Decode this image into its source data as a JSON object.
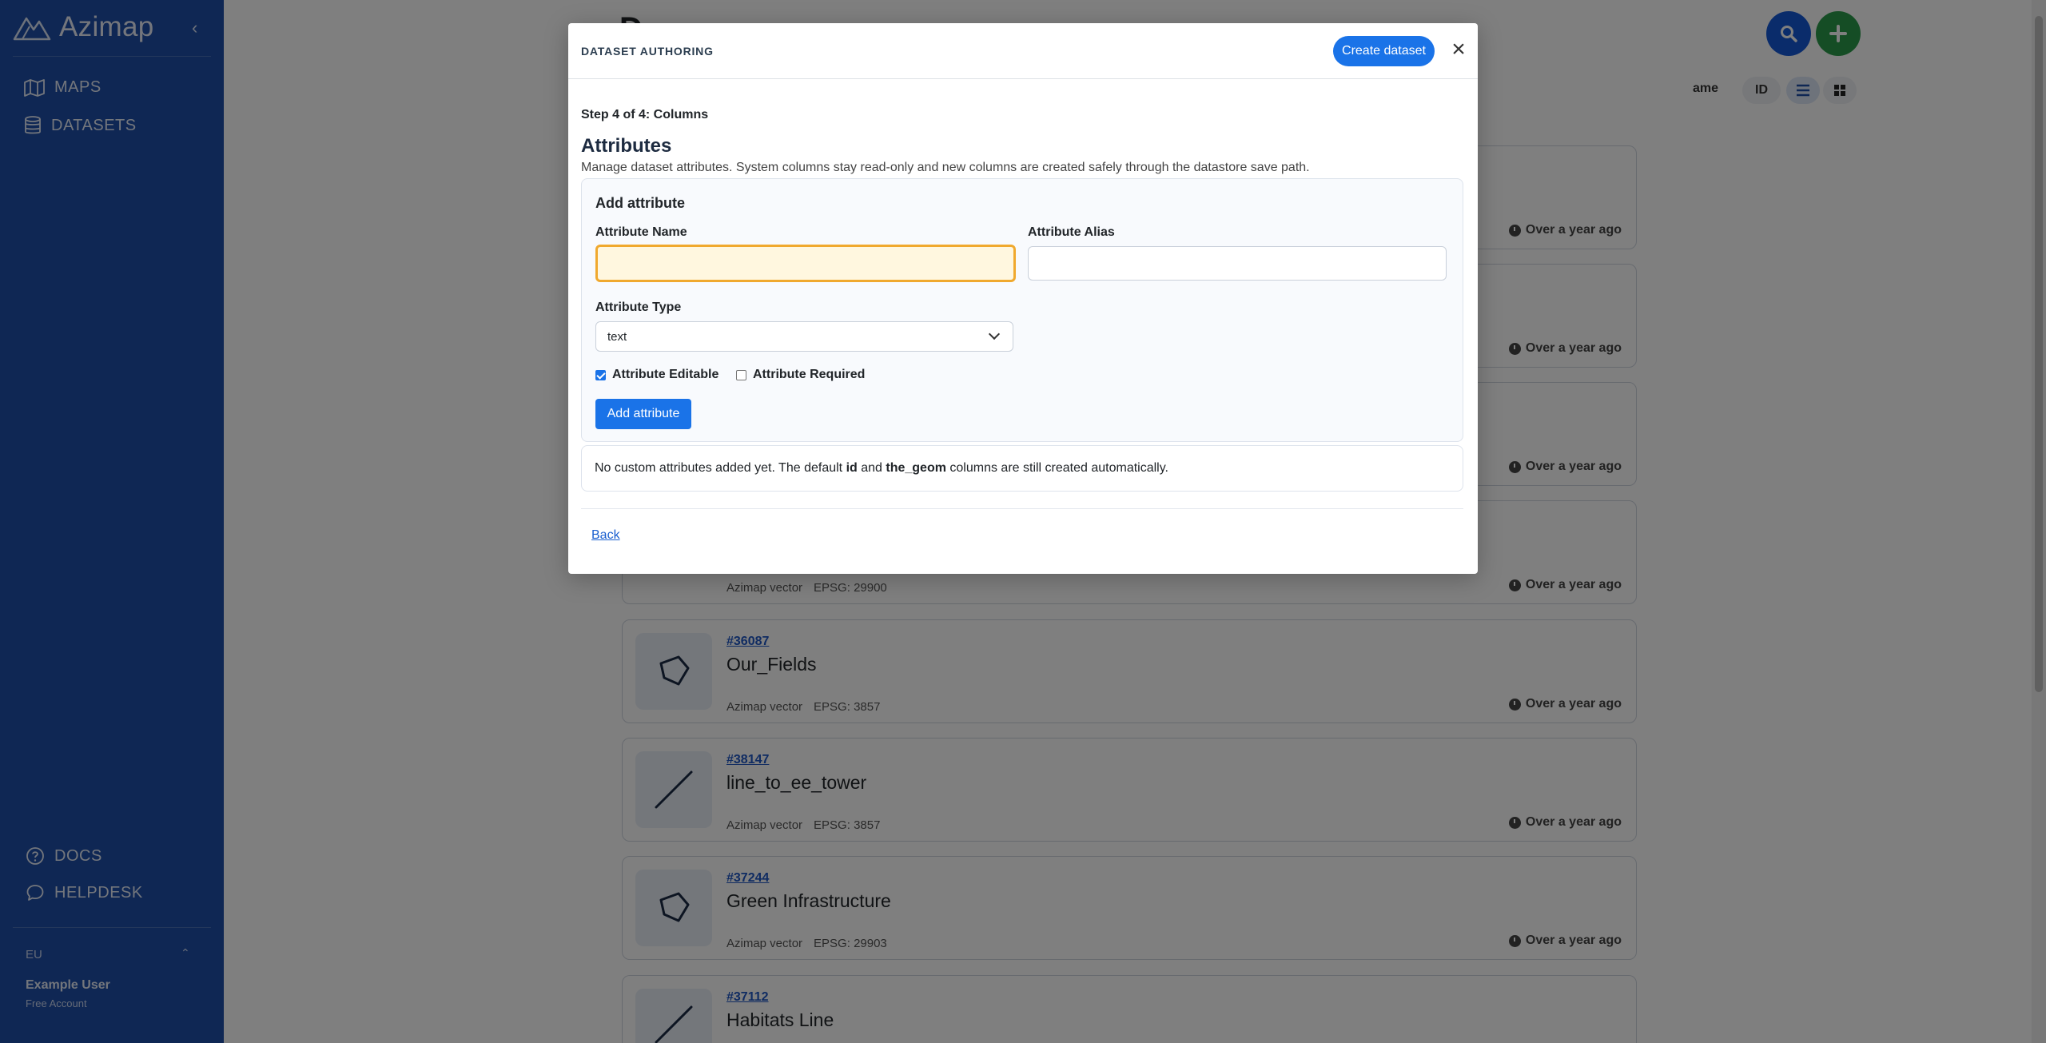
{
  "app": {
    "brand": "Azimap",
    "collapse_icon": "chevron-left-icon"
  },
  "sidebar": {
    "nav": [
      {
        "label": "MAPS",
        "icon": "map-icon"
      },
      {
        "label": "DATASETS",
        "icon": "database-icon"
      }
    ],
    "bottom": [
      {
        "label": "DOCS",
        "icon": "question-circle-icon"
      },
      {
        "label": "HELPDESK",
        "icon": "chat-icon"
      }
    ],
    "region": "EU",
    "user_name": "Example User",
    "user_plan": "Free Account"
  },
  "main": {
    "sort_name": "ame",
    "sort_id": "ID",
    "cards": [
      {
        "time": "Over a year ago"
      },
      {
        "time": "Over a year ago"
      },
      {
        "time": "Over a year ago"
      },
      {
        "type": "Azimap vector",
        "epsg": "EPSG: 29900",
        "time": "Over a year ago"
      },
      {
        "id": "#36087",
        "name": "Our_Fields",
        "type": "Azimap vector",
        "epsg": "EPSG: 3857",
        "time": "Over a year ago",
        "geom_icon": "polygon-icon"
      },
      {
        "id": "#38147",
        "name": "line_to_ee_tower",
        "type": "Azimap vector",
        "epsg": "EPSG: 3857",
        "time": "Over a year ago",
        "geom_icon": "line-icon"
      },
      {
        "id": "#37244",
        "name": "Green Infrastructure",
        "type": "Azimap vector",
        "epsg": "EPSG: 29903",
        "time": "Over a year ago",
        "geom_icon": "polygon-icon"
      },
      {
        "id": "#37112",
        "name": "Habitats Line",
        "geom_icon": "line-icon"
      }
    ]
  },
  "modal": {
    "title": "DATASET AUTHORING",
    "create_button": "Create dataset",
    "close_icon": "close-icon",
    "step": "Step 4 of 4: Columns",
    "section_title": "Attributes",
    "section_desc": "Manage dataset attributes. System columns stay read-only and new columns are created safely through the datastore save path.",
    "add_panel": {
      "title": "Add attribute",
      "name_label": "Attribute Name",
      "name_value": "",
      "alias_label": "Attribute Alias",
      "alias_value": "",
      "type_label": "Attribute Type",
      "type_value": "text",
      "editable_label": "Attribute Editable",
      "editable_checked": true,
      "required_label": "Attribute Required",
      "required_checked": false,
      "add_button": "Add attribute"
    },
    "info": {
      "prefix": "No custom attributes added yet. The default ",
      "col1": "id",
      "mid": " and ",
      "col2": "the_geom",
      "suffix": " columns are still created automatically."
    },
    "back": "Back"
  },
  "colors": {
    "sidebar": "#1f4fa8",
    "primary": "#1a73e8",
    "focus_border": "#f0a92e",
    "focus_fill": "#fff7df"
  }
}
